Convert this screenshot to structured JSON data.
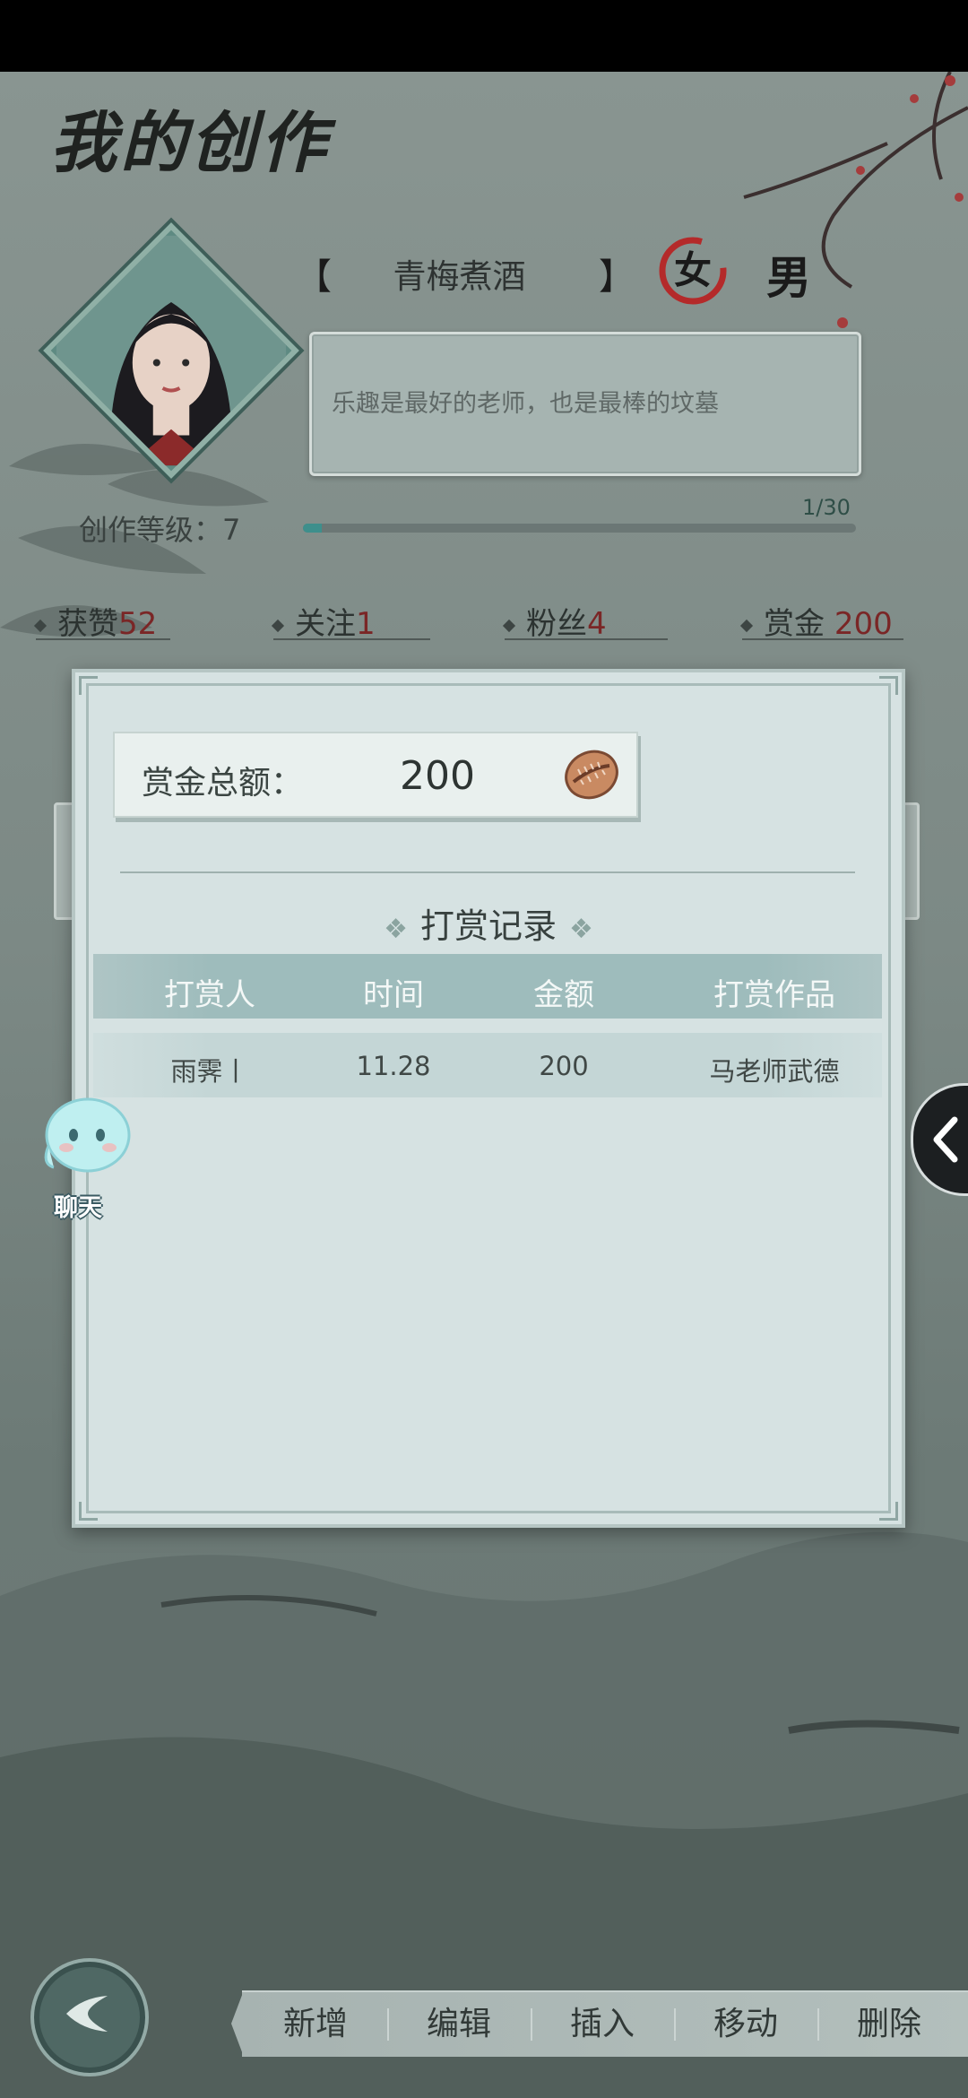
{
  "page": {
    "title": "我的创作"
  },
  "profile": {
    "name": "青梅煮酒",
    "gender_female": "女",
    "gender_male": "男",
    "bio": "乐趣是最好的老师，也是最棒的坟墓",
    "bracket_left": "【",
    "bracket_right": "】"
  },
  "level": {
    "label": "创作等级：7",
    "progress_text": "1/30",
    "progress_fraction": 0.0333
  },
  "stats": {
    "likes_label": "获赞",
    "likes": "52",
    "follows_label": "关注",
    "follows": "1",
    "fans_label": "粉丝",
    "fans": "4",
    "reward_label": "赏金",
    "reward": "200"
  },
  "reward_dialog": {
    "total_label": "赏金总额：",
    "total_value": "200",
    "currency_icon": "shell-icon",
    "records_title": "打赏记录",
    "title_ornament": "❖",
    "columns": [
      "打赏人",
      "时间",
      "金额",
      "打赏作品"
    ],
    "rows": [
      {
        "tipper": "雨霁丨",
        "time": "11.28",
        "amount": "200",
        "work": "马老师武德"
      }
    ]
  },
  "chat": {
    "label": "聊天"
  },
  "toolbar": {
    "add": "新增",
    "edit": "编辑",
    "insert": "插入",
    "move": "移动",
    "delete": "删除"
  },
  "colors": {
    "accent_number": "#7a2626",
    "header_bg": "#9ebcbc",
    "dialog_bg": "#d6e2e2"
  }
}
